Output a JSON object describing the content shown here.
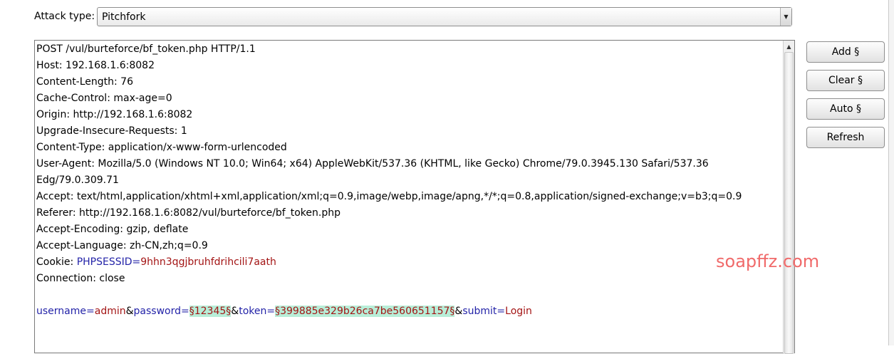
{
  "attack": {
    "label": "Attack type:",
    "selected": "Pitchfork"
  },
  "request": {
    "lines": [
      "POST /vul/burteforce/bf_token.php HTTP/1.1",
      "Host: 192.168.1.6:8082",
      "Content-Length: 76",
      "Cache-Control: max-age=0",
      "Origin: http://192.168.1.6:8082",
      "Upgrade-Insecure-Requests: 1",
      "Content-Type: application/x-www-form-urlencoded",
      "User-Agent: Mozilla/5.0 (Windows NT 10.0; Win64; x64) AppleWebKit/537.36 (KHTML, like Gecko) Chrome/79.0.3945.130 Safari/537.36",
      "Edg/79.0.309.71",
      "Accept: text/html,application/xhtml+xml,application/xml;q=0.9,image/webp,image/apng,*/*;q=0.8,application/signed-exchange;v=b3;q=0.9",
      "Referer: http://192.168.1.6:8082/vul/burteforce/bf_token.php",
      "Accept-Encoding: gzip, deflate",
      "Accept-Language: zh-CN,zh;q=0.9"
    ],
    "cookie": {
      "prefix": "Cookie: ",
      "name": "PHPSESSID",
      "eq": "=",
      "value": "9hhn3qgjbruhfdrihcili7aath"
    },
    "connection": "Connection: close",
    "body": {
      "k_username": "username",
      "eq1": "=",
      "v_username": "admin",
      "amp1": "&",
      "k_password": "password",
      "eq2": "=",
      "v_password": "§12345§",
      "amp2": "&",
      "k_token": "token",
      "eq3": "=",
      "v_token": "§399885e329b26ca7be560651157§",
      "amp3": "&",
      "k_submit": "submit",
      "eq4": "=",
      "v_submit": "Login"
    }
  },
  "buttons": {
    "add": "Add §",
    "clear": "Clear §",
    "auto": "Auto §",
    "refresh": "Refresh"
  },
  "watermark": "soapffz.com",
  "colors": {
    "param_name": "#2323a8",
    "param_value": "#a31414",
    "payload_marker_bg": "#b8eed8",
    "watermark": "#f06a6a"
  }
}
